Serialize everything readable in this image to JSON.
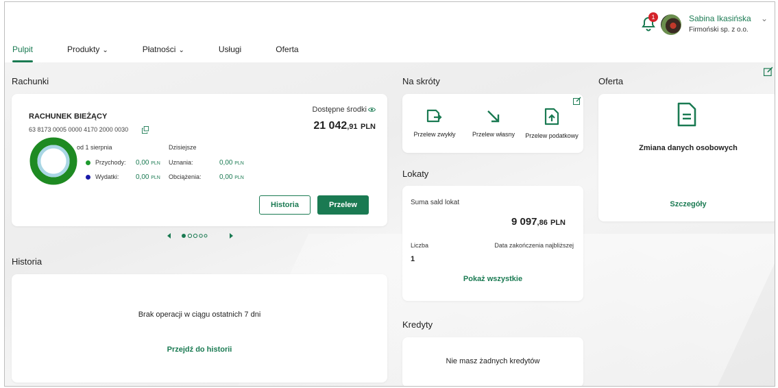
{
  "user": {
    "name": "Sabina Ikasińska",
    "company": "Firmoński sp. z o.o.",
    "notifications": "1"
  },
  "nav": {
    "items": [
      {
        "label": "Pulpit",
        "active": true,
        "dropdown": false
      },
      {
        "label": "Produkty",
        "active": false,
        "dropdown": true
      },
      {
        "label": "Płatności",
        "active": false,
        "dropdown": true
      },
      {
        "label": "Usługi",
        "active": false,
        "dropdown": false
      },
      {
        "label": "Oferta",
        "active": false,
        "dropdown": false
      }
    ]
  },
  "accounts": {
    "title": "Rachunki",
    "card": {
      "name": "RACHUNEK BIEŻĄCY",
      "number": "63 8173 0005 0000 4170 2000 0030",
      "available_label": "Dostępne środki",
      "available_int": "21 042",
      "available_dec": ",91",
      "available_cur": "PLN",
      "period_label": "od 1 sierpnia",
      "today_label": "Dzisiejsze",
      "income_label": "Przychody:",
      "income_value": "0,00",
      "expense_label": "Wydatki:",
      "expense_value": "0,00",
      "credits_label": "Uznania:",
      "credits_value": "0,00",
      "debits_label": "Obciążenia:",
      "debits_value": "0,00",
      "currency_small": "PLN",
      "history_button": "Historia",
      "transfer_button": "Przelew"
    },
    "carousel": {
      "current": 1,
      "total": 5
    }
  },
  "history": {
    "title": "Historia",
    "empty_text": "Brak operacji w ciągu ostatnich 7 dni",
    "link": "Przejdź do historii"
  },
  "shortcuts": {
    "title": "Na skróty",
    "items": [
      {
        "label": "Przelew zwykły",
        "icon": "transfer-regular-icon"
      },
      {
        "label": "Przelew własny",
        "icon": "transfer-own-icon"
      },
      {
        "label": "Przelew podatkowy",
        "icon": "transfer-tax-icon"
      }
    ]
  },
  "deposits": {
    "title": "Lokaty",
    "sum_label": "Suma sald lokat",
    "sum_int": "9 097",
    "sum_dec": ",86",
    "sum_cur": "PLN",
    "count_label": "Liczba",
    "count_value": "1",
    "nearest_label": "Data zakończenia najbliższej",
    "link": "Pokaż wszystkie"
  },
  "credits": {
    "title": "Kredyty",
    "empty_text": "Nie masz żadnych kredytów"
  },
  "offer": {
    "title": "Oferta",
    "card_title": "Zmiana danych osobowych",
    "link": "Szczegóły"
  },
  "colors": {
    "brand_green": "#1a7a52",
    "income_dot": "#1e9a2e",
    "expense_dot": "#1a1aa8",
    "badge_red": "#d4232a"
  }
}
